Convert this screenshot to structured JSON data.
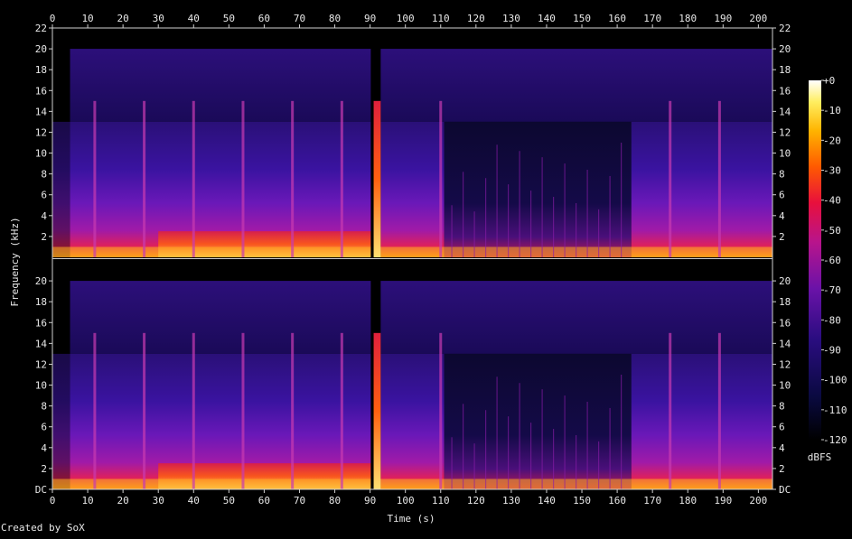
{
  "chart_data": {
    "type": "heatmap",
    "title": "",
    "xlabel": "Time (s)",
    "ylabel": "Frequency (kHz)",
    "x_ticks": [
      "0",
      "10",
      "20",
      "30",
      "40",
      "50",
      "60",
      "70",
      "80",
      "90",
      "100",
      "110",
      "120",
      "130",
      "140",
      "150",
      "160",
      "170",
      "180",
      "190",
      "200"
    ],
    "xlim": [
      0,
      204
    ],
    "y_ticks_top": [
      "2",
      "4",
      "6",
      "8",
      "10",
      "12",
      "14",
      "16",
      "18",
      "20",
      "22"
    ],
    "y_ticks_bottom": [
      "DC",
      "2",
      "4",
      "6",
      "8",
      "10",
      "12",
      "14",
      "16",
      "18",
      "20"
    ],
    "ylim_khz": [
      0,
      22
    ],
    "channels": 2,
    "colorbar": {
      "label": "dBFS",
      "ticks": [
        "+0",
        "-10",
        "-20",
        "-30",
        "-40",
        "-50",
        "-60",
        "-70",
        "-80",
        "-90",
        "-100",
        "-110",
        "-120"
      ],
      "range": [
        -120,
        0
      ]
    },
    "segments": [
      {
        "start": 0,
        "end": 5,
        "desc": "fade-in"
      },
      {
        "start": 5,
        "end": 91,
        "cutoff_khz": 13,
        "full_band_to_khz": 20
      },
      {
        "start": 91,
        "end": 93,
        "desc": "transient"
      },
      {
        "start": 93,
        "end": 111,
        "cutoff_khz": 13
      },
      {
        "start": 111,
        "end": 164,
        "cutoff_khz": 13,
        "desc": "sparse tonal"
      },
      {
        "start": 164,
        "end": 204,
        "cutoff_khz": 13
      }
    ],
    "periodic_spikes_s": [
      12,
      26,
      40,
      54,
      68,
      82,
      110,
      175,
      189
    ]
  },
  "footer": {
    "credit": "Created by SoX"
  }
}
